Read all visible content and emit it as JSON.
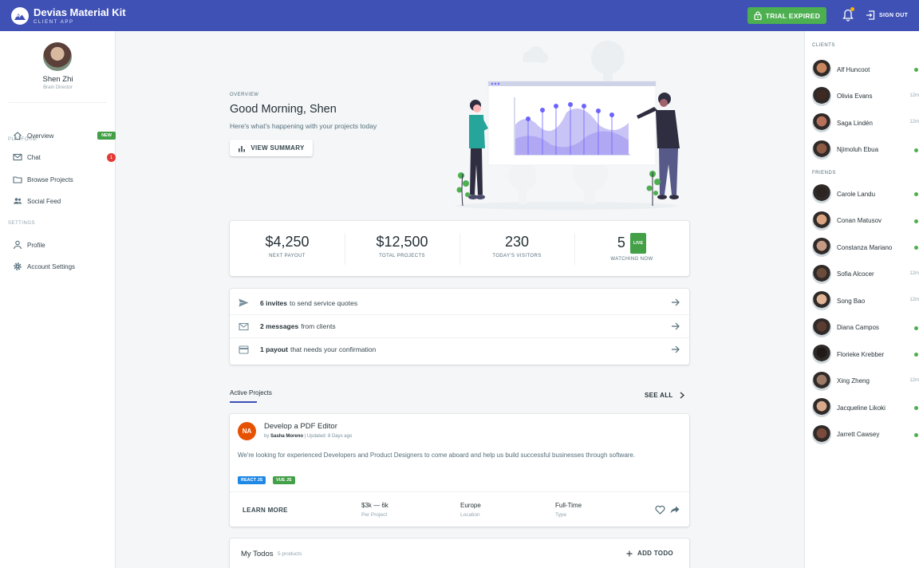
{
  "topbar": {
    "brand_title": "Devias Material Kit",
    "brand_subtitle": "CLIENT APP",
    "trial_label": "TRIAL EXPIRED",
    "signout_label": "SIGN OUT",
    "bell_icon": "bell-icon",
    "has_notification_dot": true
  },
  "user": {
    "name": "Shen Zhi",
    "role": "Brain Director"
  },
  "sidebar": {
    "platform_label": "PLATFORM",
    "settings_label": "SETTINGS",
    "items": [
      {
        "label": "Overview",
        "icon": "home-icon",
        "badge": "NEW"
      },
      {
        "label": "Chat",
        "icon": "mail-icon",
        "badge": "1"
      },
      {
        "label": "Browse Projects",
        "icon": "folder-icon"
      },
      {
        "label": "Social Feed",
        "icon": "people-icon"
      }
    ],
    "settings_items": [
      {
        "label": "Profile",
        "icon": "person-icon"
      },
      {
        "label": "Account Settings",
        "icon": "gear-icon"
      }
    ]
  },
  "hero": {
    "overline": "OVERVIEW",
    "greeting": "Good Morning, Shen",
    "subtitle": "Here's what's happening with your projects today",
    "summary_label": "VIEW SUMMARY"
  },
  "stats": [
    {
      "value": "$4,250",
      "label": "NEXT PAYOUT"
    },
    {
      "value": "$12,500",
      "label": "TOTAL PROJECTS"
    },
    {
      "value": "230",
      "label": "TODAY'S VISITORS"
    },
    {
      "value": "5",
      "label": "WATCHING NOW",
      "badge": "LIVE"
    }
  ],
  "notifications": [
    {
      "bold": "6 invites",
      "text": "to send service quotes",
      "icon": "send-icon"
    },
    {
      "bold": "2 messages",
      "text": "from clients",
      "icon": "mail-icon"
    },
    {
      "bold": "1 payout",
      "text": "that needs your confirmation",
      "icon": "credit-card-icon"
    }
  ],
  "projects_section": {
    "tab_label": "Active Projects",
    "see_all_label": "SEE ALL"
  },
  "project": {
    "avatar_initials": "NA",
    "title": "Develop a PDF Editor",
    "by_prefix": "by",
    "author": "Sasha Moreno",
    "updated": "| Updated: 8 Days ago",
    "description": "We're looking for experienced Developers and Product Designers to come aboard and help us build successful businesses through software.",
    "tags": [
      {
        "label": "REACT JS",
        "color": "#1e88e5"
      },
      {
        "label": "VUE JS",
        "color": "#43a047"
      }
    ],
    "learn_more_label": "LEARN MORE",
    "budget": {
      "value": "$3k — 6k",
      "caption": "Per Project"
    },
    "location": {
      "value": "Europe",
      "caption": "Location"
    },
    "type": {
      "value": "Full-Time",
      "caption": "Type"
    }
  },
  "todos": {
    "title": "My Todos",
    "count": "5 products",
    "add_label": "ADD TODO"
  },
  "contacts": {
    "clients_label": "CLIENTS",
    "friends_label": "FRIENDS",
    "clients": [
      {
        "name": "Alf Huncoot",
        "status": "online"
      },
      {
        "name": "Olivia Evans",
        "status": "12m"
      },
      {
        "name": "Saga Lindén",
        "status": "12m"
      },
      {
        "name": "Njimoluh Ebua",
        "status": "online"
      }
    ],
    "friends": [
      {
        "name": "Carole Landu",
        "status": "online"
      },
      {
        "name": "Conan Matusov",
        "status": "online"
      },
      {
        "name": "Constanza Mariano",
        "status": "online"
      },
      {
        "name": "Sofia Alcocer",
        "status": "12m"
      },
      {
        "name": "Song Bao",
        "status": "12m"
      },
      {
        "name": "Diana Campos",
        "status": "online"
      },
      {
        "name": "Florieke Krebber",
        "status": "online"
      },
      {
        "name": "Xing Zheng",
        "status": "12m"
      },
      {
        "name": "Jacqueline Likoki",
        "status": "online"
      },
      {
        "name": "Jarrett Cawsey",
        "status": "online"
      }
    ]
  },
  "colors": {
    "primary": "#3f51b5",
    "success": "#4caf50",
    "error": "#e53935",
    "warning": "#ffb300"
  }
}
